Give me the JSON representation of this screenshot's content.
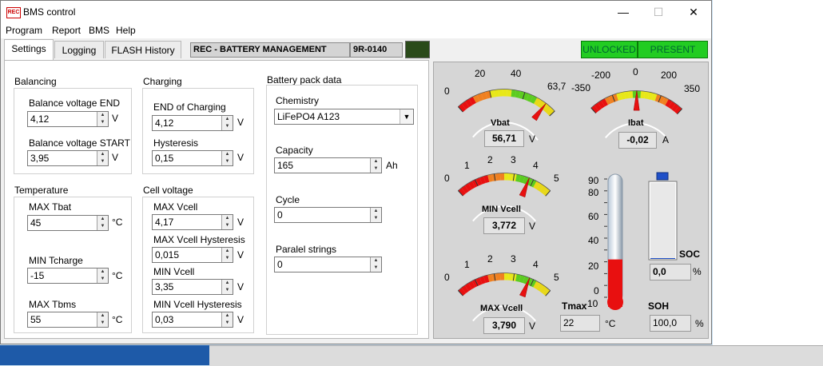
{
  "window": {
    "title": "BMS control",
    "min": "—",
    "max": "☐",
    "close": "✕",
    "icon_text": "REC"
  },
  "menu": [
    "Program",
    "Report",
    "BMS",
    "Help"
  ],
  "tabs": [
    "Settings",
    "Logging",
    "FLASH History"
  ],
  "header": {
    "device_name": "REC - BATTERY MANAGEMENT",
    "device_code": "9R-0140",
    "unlocked": "UNLOCKED",
    "present": "PRESENT"
  },
  "balancing": {
    "title": "Balancing",
    "end_label": "Balance voltage END",
    "end_value": "4,12",
    "start_label": "Balance voltage START",
    "start_value": "3,95",
    "unit": "V"
  },
  "charging": {
    "title": "Charging",
    "end_label": "END of Charging",
    "end_value": "4,12",
    "hyst_label": "Hysteresis",
    "hyst_value": "0,15",
    "unit": "V"
  },
  "temperature": {
    "title": "Temperature",
    "max_tbat_label": "MAX Tbat",
    "max_tbat_value": "45",
    "min_tcharge_label": "MIN Tcharge",
    "min_tcharge_value": "-15",
    "max_tbms_label": "MAX Tbms",
    "max_tbms_value": "55",
    "unit": "°C"
  },
  "cell_voltage": {
    "title": "Cell voltage",
    "max_label": "MAX Vcell",
    "max_value": "4,17",
    "max_hyst_label": "MAX Vcell Hysteresis",
    "max_hyst_value": "0,015",
    "min_label": "MIN Vcell",
    "min_value": "3,35",
    "min_hyst_label": "MIN Vcell Hysteresis",
    "min_hyst_value": "0,03",
    "unit": "V"
  },
  "pack": {
    "title": "Battery pack data",
    "chem_label": "Chemistry",
    "chem_value": "LiFePO4 A123",
    "cap_label": "Capacity",
    "cap_value": "165",
    "cap_unit": "Ah",
    "cycle_label": "Cycle",
    "cycle_value": "0",
    "strings_label": "Paralel strings",
    "strings_value": "0"
  },
  "gauges": {
    "vbat": {
      "label": "Vbat",
      "readout": "56,71",
      "unit": "V",
      "ticks": [
        "0",
        "20",
        "40",
        "63,7"
      ],
      "value": 56.71,
      "min": 0,
      "max": 63.7
    },
    "ibat": {
      "label": "Ibat",
      "readout": "-0,02",
      "unit": "A",
      "ticks": [
        "-350",
        "-200",
        "0",
        "200",
        "350"
      ],
      "value": -0.02,
      "min": -350,
      "max": 350
    },
    "minv": {
      "label": "MIN Vcell",
      "readout": "3,772",
      "unit": "V",
      "ticks": [
        "0",
        "1",
        "2",
        "3",
        "4",
        "5"
      ],
      "value": 3.772,
      "min": 0,
      "max": 5
    },
    "maxv": {
      "label": "MAX Vcell",
      "readout": "3,790",
      "unit": "V",
      "ticks": [
        "0",
        "1",
        "2",
        "3",
        "4",
        "5"
      ],
      "value": 3.79,
      "min": 0,
      "max": 5
    }
  },
  "thermo": {
    "label": "Tmax",
    "readout": "22",
    "unit": "°C",
    "ticks": [
      "90",
      "80",
      "60",
      "40",
      "20",
      "0",
      "-10"
    ],
    "value": 22,
    "min": -10,
    "max": 90
  },
  "soc": {
    "label": "SOC",
    "readout": "0,0",
    "unit": "%",
    "value": 0.0
  },
  "soh": {
    "label": "SOH",
    "readout": "100,0",
    "unit": "%"
  },
  "colors": {
    "green": "#22cc22",
    "red": "#e81010",
    "yellow": "#e8e818"
  }
}
